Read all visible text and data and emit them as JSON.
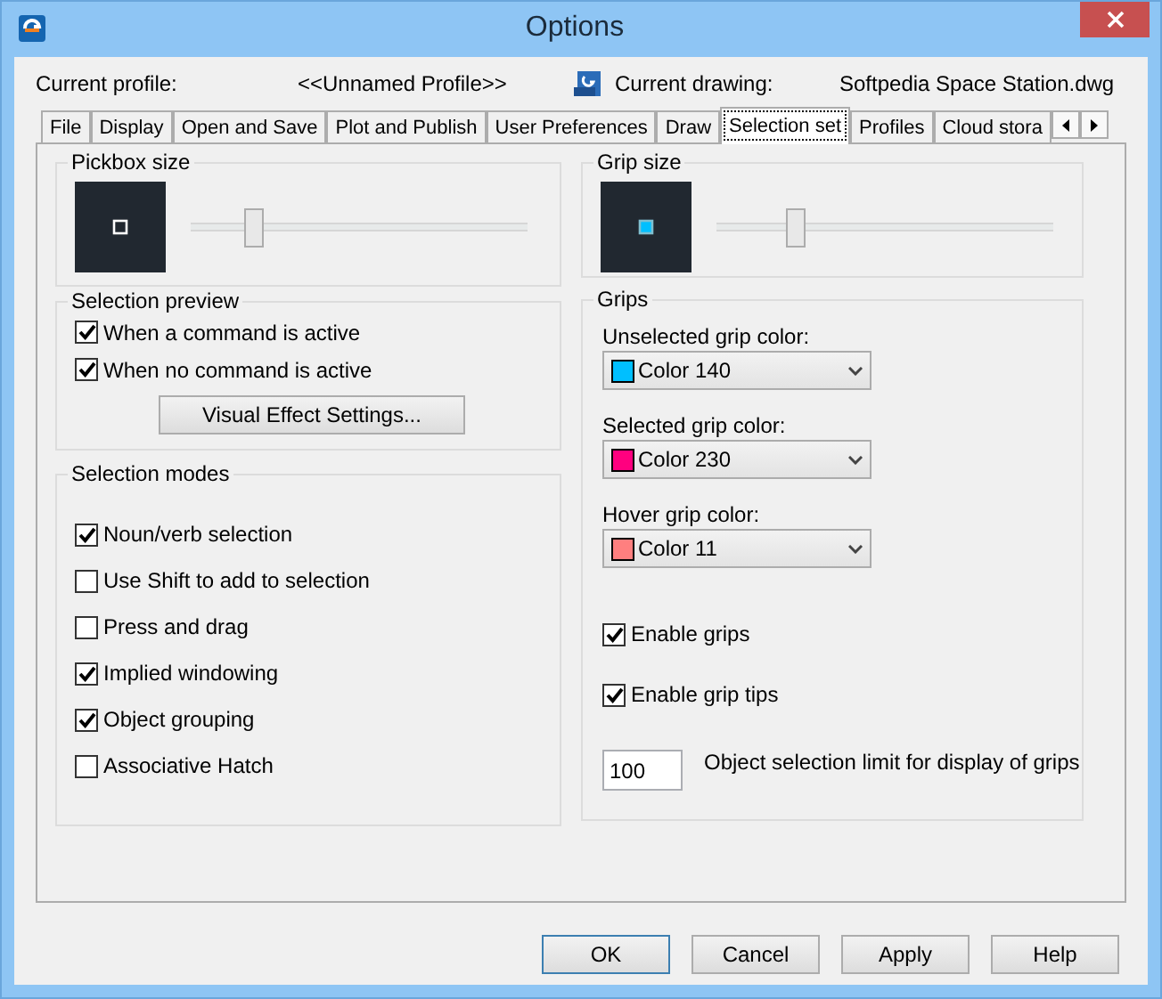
{
  "window": {
    "title": "Options"
  },
  "profile": {
    "label": "Current profile:",
    "value": "<<Unnamed Profile>>",
    "drawing_label": "Current drawing:",
    "drawing_value": "Softpedia Space Station.dwg"
  },
  "tabs": [
    {
      "label": "File",
      "selected": false
    },
    {
      "label": "Display",
      "selected": false
    },
    {
      "label": "Open and Save",
      "selected": false
    },
    {
      "label": "Plot and Publish",
      "selected": false
    },
    {
      "label": "User Preferences",
      "selected": false
    },
    {
      "label": "Draw",
      "selected": false
    },
    {
      "label": "Selection set",
      "selected": true
    },
    {
      "label": "Profiles",
      "selected": false
    },
    {
      "label": "Cloud stora",
      "selected": false
    }
  ],
  "pickbox": {
    "title": "Pickbox size",
    "level": 0.17
  },
  "selection_preview": {
    "title": "Selection preview",
    "options": [
      {
        "label": "When a command is active",
        "checked": true
      },
      {
        "label": "When no command is active",
        "checked": true
      }
    ],
    "button": "Visual Effect Settings..."
  },
  "selection_modes": {
    "title": "Selection modes",
    "options": [
      {
        "label": "Noun/verb selection",
        "checked": true
      },
      {
        "label": "Use Shift to add to selection",
        "checked": false
      },
      {
        "label": "Press and drag",
        "checked": false
      },
      {
        "label": "Implied windowing",
        "checked": true
      },
      {
        "label": "Object grouping",
        "checked": true
      },
      {
        "label": "Associative Hatch",
        "checked": false
      }
    ]
  },
  "grip_size": {
    "title": "Grip size",
    "level": 0.22
  },
  "grips": {
    "title": "Grips",
    "colors": [
      {
        "label": "Unselected grip color:",
        "value": "Color 140",
        "color": "#00bfff"
      },
      {
        "label": "Selected grip color:",
        "value": "Color 230",
        "color": "#ff007f"
      },
      {
        "label": "Hover grip color:",
        "value": "Color 11",
        "color": "#ff7f7f"
      }
    ],
    "options": [
      {
        "label": "Enable grips",
        "checked": true
      },
      {
        "label": "Enable grip tips",
        "checked": true
      }
    ],
    "limit": {
      "value": "100",
      "label": "Object selection limit for display of grips"
    }
  },
  "buttons": [
    "OK",
    "Cancel",
    "Apply",
    "Help"
  ]
}
